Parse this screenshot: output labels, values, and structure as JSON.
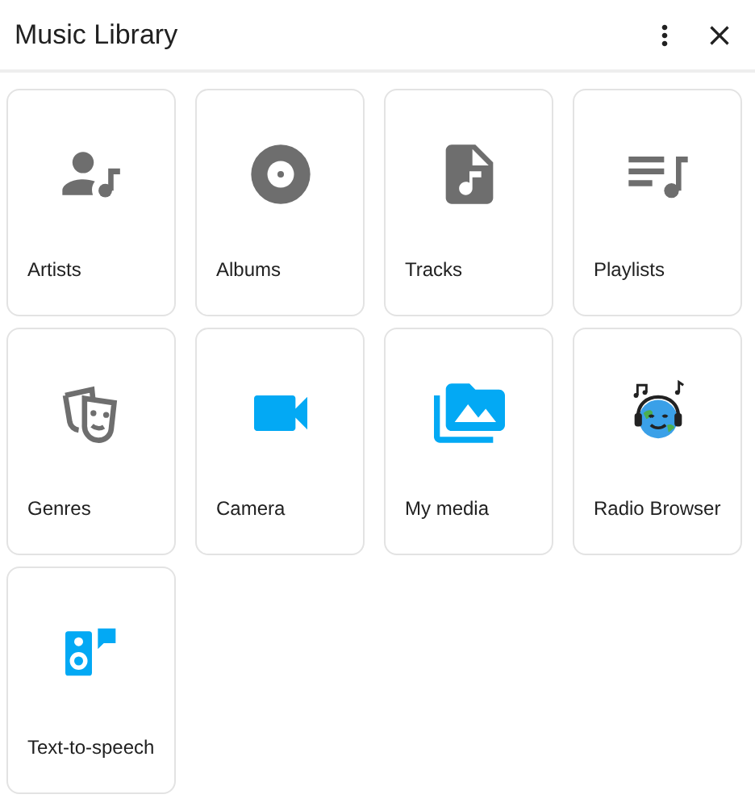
{
  "window": {
    "title": "Music Library"
  },
  "items": [
    {
      "label": "Artists",
      "kind": "artists"
    },
    {
      "label": "Albums",
      "kind": "albums"
    },
    {
      "label": "Tracks",
      "kind": "tracks"
    },
    {
      "label": "Playlists",
      "kind": "playlists"
    },
    {
      "label": "Genres",
      "kind": "genres"
    },
    {
      "label": "Camera",
      "kind": "camera"
    },
    {
      "label": "My media",
      "kind": "media"
    },
    {
      "label": "Radio Browser",
      "kind": "radio"
    },
    {
      "label": "Text-to-speech",
      "kind": "tts"
    }
  ]
}
